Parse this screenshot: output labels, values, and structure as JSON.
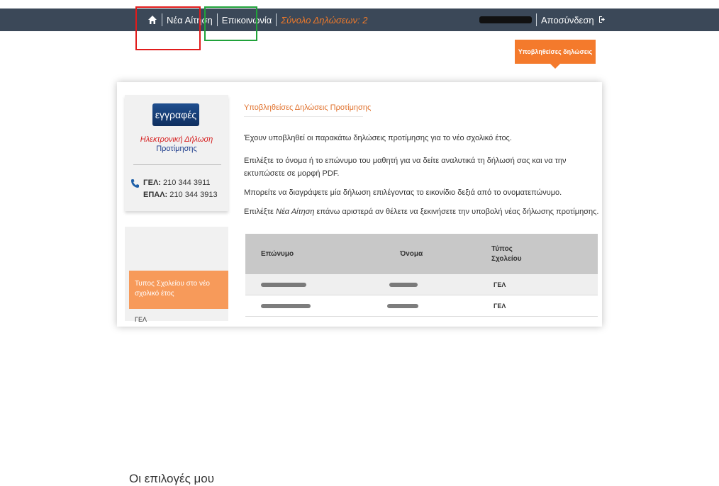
{
  "topbar": {
    "new_application": "Νέα Αίτηση",
    "contact": "Επικοινωνία",
    "total_submissions": "Σύνολο Δηλώσεων: 2",
    "logout": "Αποσύνδεση"
  },
  "submitted_button": "Υποβληθείσες δηλώσεις",
  "sidebar": {
    "logo_text": "εγγραφές",
    "logo_line1": "Ηλεκτρονική Δήλωση",
    "logo_line2": "Προτίμησης",
    "phone_gel_label": "ΓΕΛ:",
    "phone_gel": "210 344 3911",
    "phone_epal_label": "ΕΠΑΛ:",
    "phone_epal": "210 344 3913",
    "choices_title": "Οι επιλογές μου",
    "choice_item": "Τυπος Σχολείου στο νέο σχολικό έτος",
    "choice_value": "ΓΕΛ"
  },
  "content": {
    "heading": "Υποβληθείσες Δηλώσεις Προτίμησης",
    "p1": "Έχουν υποβληθεί οι παρακάτω δηλώσεις προτίμησης για το νέο σχολικό έτος.",
    "p2": "Επιλέξτε το όνομα ή το επώνυμο του μαθητή για να δείτε αναλυτικά τη δήλωσή σας και να την εκτυπώσετε σε μορφή PDF.",
    "p3": "Μπορείτε να διαγράψετε μία δήλωση επιλέγοντας το εικονίδιο δεξιά από το ονοματεπώνυμο.",
    "p4_pre": "Επιλέξτε ",
    "p4_em": "Νέα Αίτηση",
    "p4_post": " επάνω αριστερά αν θέλετε να ξεκινήσετε την υποβολή νέας δήλωσης προτίμησης."
  },
  "table": {
    "headers": [
      "Επώνυμο",
      "Όνομα",
      "Τύπος Σχολείου"
    ],
    "rows": [
      {
        "school_type": "ΓΕΛ"
      },
      {
        "school_type": "ΓΕΛ"
      }
    ]
  },
  "colors": {
    "topbar": "#3b4858",
    "accent_orange": "#f47a2c",
    "highlight_red": "#e11b1b",
    "highlight_green": "#20a23a"
  }
}
